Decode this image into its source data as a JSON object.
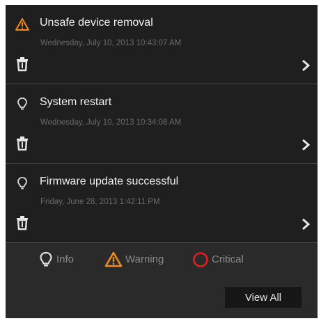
{
  "notifications": [
    {
      "type": "warning",
      "type_icon": "warning-icon",
      "title": "Unsafe device removal",
      "timestamp": "Wednesday, July 10, 2013 10:43:07 AM"
    },
    {
      "type": "info",
      "type_icon": "lightbulb-icon",
      "title": "System restart",
      "timestamp": "Wednesday, July 10, 2013 10:34:08 AM"
    },
    {
      "type": "info",
      "type_icon": "lightbulb-icon",
      "title": "Firmware update successful",
      "timestamp": "Friday, June 28, 2013 1:42:11 PM"
    }
  ],
  "legend": {
    "info_label": "Info",
    "warning_label": "Warning",
    "critical_label": "Critical"
  },
  "view_all_label": "View All",
  "colors": {
    "panel_bg": "#2a2a2a",
    "item_bg": "#1f1f1f",
    "warning": "#f08a1c",
    "critical": "#e0201c",
    "info": "#dcdcdc"
  }
}
